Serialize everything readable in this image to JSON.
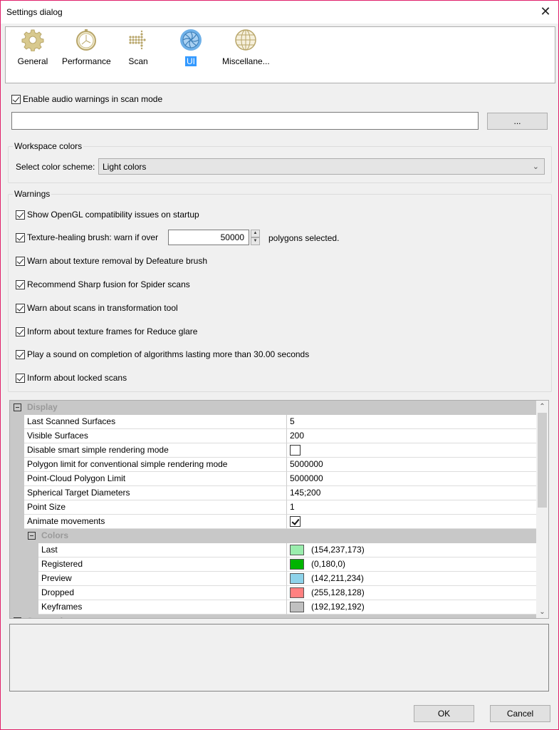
{
  "window": {
    "title": "Settings dialog",
    "close_glyph": "✕"
  },
  "nav": {
    "items": [
      {
        "label": "General",
        "icon": "gear-icon",
        "active": false
      },
      {
        "label": "Performance",
        "icon": "stopwatch-icon",
        "active": false
      },
      {
        "label": "Scan",
        "icon": "dot-arrow-icon",
        "active": false
      },
      {
        "label": "UI",
        "icon": "aperture-icon",
        "active": true
      },
      {
        "label": "Miscellane...",
        "icon": "globe-icon",
        "active": false
      }
    ]
  },
  "audio": {
    "enable_label": "Enable audio warnings in scan mode",
    "enabled": true,
    "path_value": "",
    "browse_label": "..."
  },
  "workspace_colors": {
    "title": "Workspace colors",
    "scheme_label": "Select color scheme:",
    "scheme_value": "Light colors"
  },
  "warnings": {
    "title": "Warnings",
    "items": [
      {
        "label": "Show OpenGL compatibility issues on startup",
        "checked": true
      },
      {
        "label": "Texture-healing brush: warn if over",
        "checked": true
      },
      {
        "label": "Warn about texture removal by Defeature brush",
        "checked": true
      },
      {
        "label": "Recommend Sharp fusion for Spider scans",
        "checked": true
      },
      {
        "label": "Warn about scans in transformation tool",
        "checked": true
      },
      {
        "label": "Inform about texture frames for Reduce glare",
        "checked": true
      },
      {
        "label": "Play a sound on completion of algorithms lasting more than 30.00 seconds",
        "checked": true
      },
      {
        "label": "Inform about locked scans",
        "checked": true
      }
    ],
    "polygon_threshold": "50000",
    "polygon_suffix": "polygons selected."
  },
  "properties": {
    "display_group": "Display",
    "rows": [
      {
        "name": "Last Scanned Surfaces",
        "value": "5"
      },
      {
        "name": "Visible Surfaces",
        "value": "200"
      },
      {
        "name": "Disable smart simple rendering mode",
        "type": "checkbox",
        "checked": false
      },
      {
        "name": "Polygon limit for conventional simple rendering mode",
        "value": "5000000"
      },
      {
        "name": "Point-Cloud Polygon Limit",
        "value": "5000000"
      },
      {
        "name": "Spherical Target Diameters",
        "value": "145;200"
      },
      {
        "name": "Point Size",
        "value": "1"
      },
      {
        "name": "Animate movements",
        "type": "checkbox",
        "checked": true
      }
    ],
    "colors_group": "Colors",
    "colors": [
      {
        "name": "Last",
        "value": "(154,237,173)",
        "hex": "#9aedad"
      },
      {
        "name": "Registered",
        "value": "(0,180,0)",
        "hex": "#00b400"
      },
      {
        "name": "Preview",
        "value": "(142,211,234)",
        "hex": "#8ed3ea"
      },
      {
        "name": "Dropped",
        "value": "(255,128,128)",
        "hex": "#ff8080"
      },
      {
        "name": "Keyframes",
        "value": "(192,192,192)",
        "hex": "#c0c0c0"
      }
    ],
    "next_group": "Screenshots"
  },
  "footer": {
    "ok_label": "OK",
    "cancel_label": "Cancel"
  }
}
